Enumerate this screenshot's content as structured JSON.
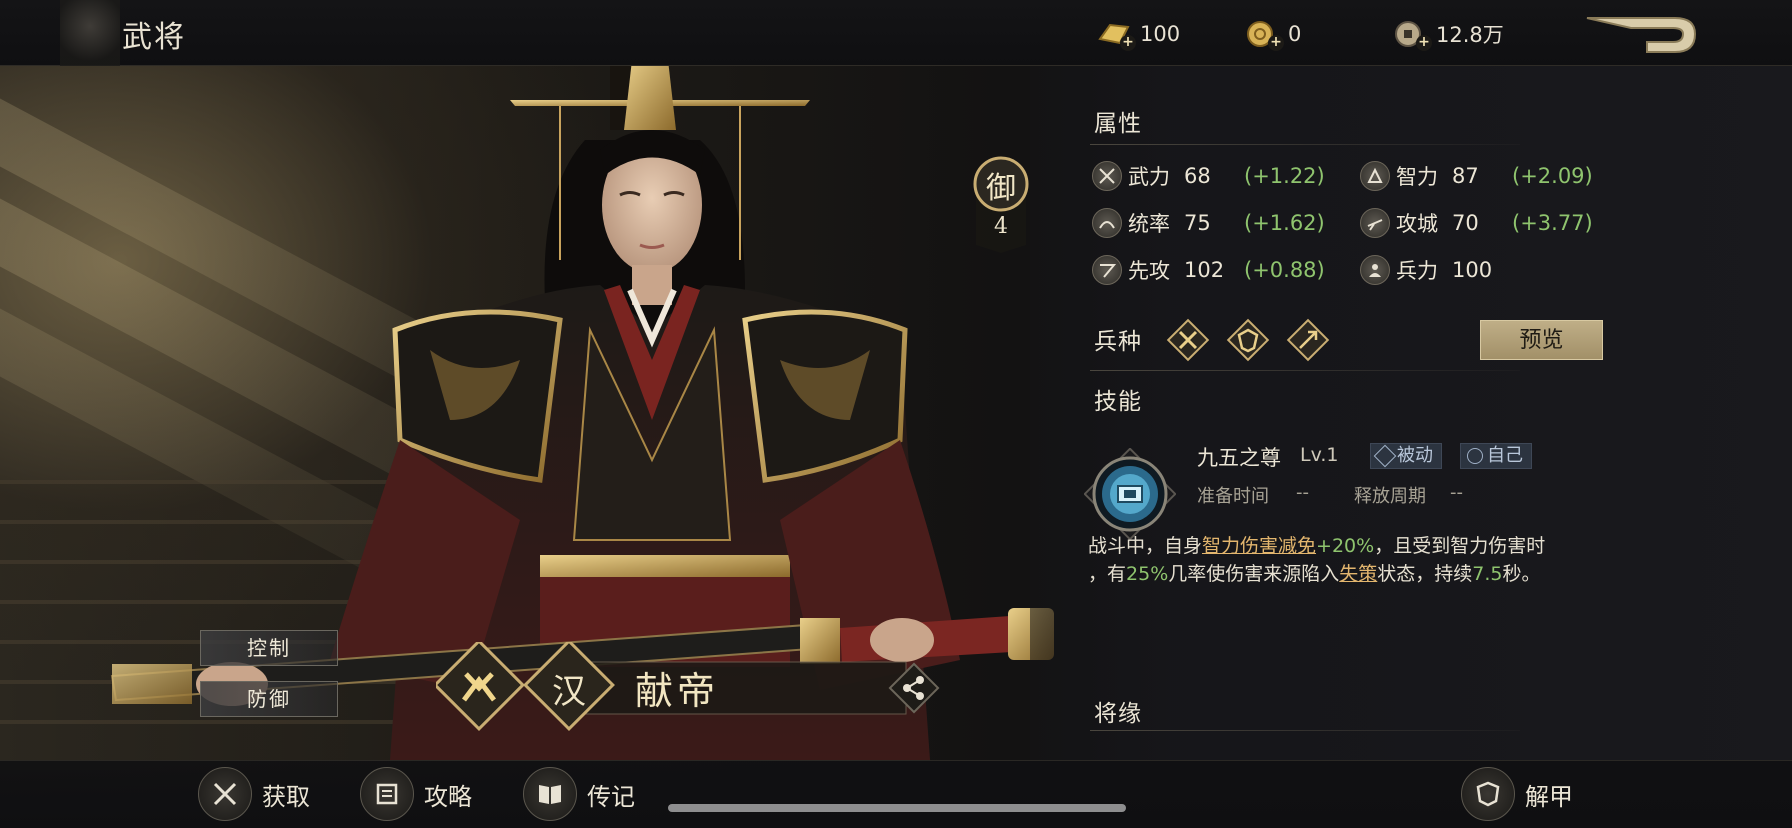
{
  "header": {
    "title": "武将",
    "currencies": [
      {
        "icon": "gold-bar-icon",
        "value": "100"
      },
      {
        "icon": "gold-coin-icon",
        "value": "0"
      },
      {
        "icon": "copper-coin-icon",
        "value": "12.8万"
      }
    ],
    "back_icon": "back-arrow-icon"
  },
  "hero": {
    "name": "献帝",
    "faction_glyph": "汉",
    "roles": [
      "控制",
      "防御"
    ],
    "rank_label": "御",
    "rank_value": "4"
  },
  "attributes": {
    "title": "属性",
    "items": [
      {
        "name": "武力",
        "value": "68",
        "bonus": "(+1.22)",
        "icon": "swords-icon"
      },
      {
        "name": "智力",
        "value": "87",
        "bonus": "(+2.09)",
        "icon": "brain-icon"
      },
      {
        "name": "统率",
        "value": "75",
        "bonus": "(+1.62)",
        "icon": "command-icon"
      },
      {
        "name": "攻城",
        "value": "70",
        "bonus": "(+3.77)",
        "icon": "siege-icon"
      },
      {
        "name": "先攻",
        "value": "102",
        "bonus": "(+0.88)",
        "icon": "initiative-icon"
      },
      {
        "name": "兵力",
        "value": "100",
        "bonus": "",
        "icon": "troops-icon"
      }
    ]
  },
  "troop_types": {
    "title": "兵种",
    "icons": [
      "cavalry-icon",
      "shield-icon",
      "archer-icon"
    ],
    "preview_label": "预览"
  },
  "skill": {
    "title": "技能",
    "name": "九五之尊",
    "level": "Lv.1",
    "tags": [
      "被动",
      "自己"
    ],
    "prep_label": "准备时间",
    "prep_value": "--",
    "release_label": "释放周期",
    "release_value": "--",
    "desc": {
      "p1": "战斗中，自身",
      "link1": "智力伤害减免",
      "num1": "+20%",
      "p2": "，且受到智力伤害时",
      "p3": "，有",
      "num2": "25%",
      "p4": "几率使伤害来源陷入",
      "link2": "失策",
      "p5": "状态，持续",
      "num3": "7.5",
      "p6": "秒。"
    }
  },
  "fate": {
    "title": "将缘"
  },
  "bottom": {
    "obtain": "获取",
    "guide": "攻略",
    "biography": "传记",
    "unequip": "解甲"
  },
  "colors": {
    "accent_gold": "#c9ad72",
    "bonus_green": "#8fc46e",
    "link_orange": "#e3b66e"
  }
}
